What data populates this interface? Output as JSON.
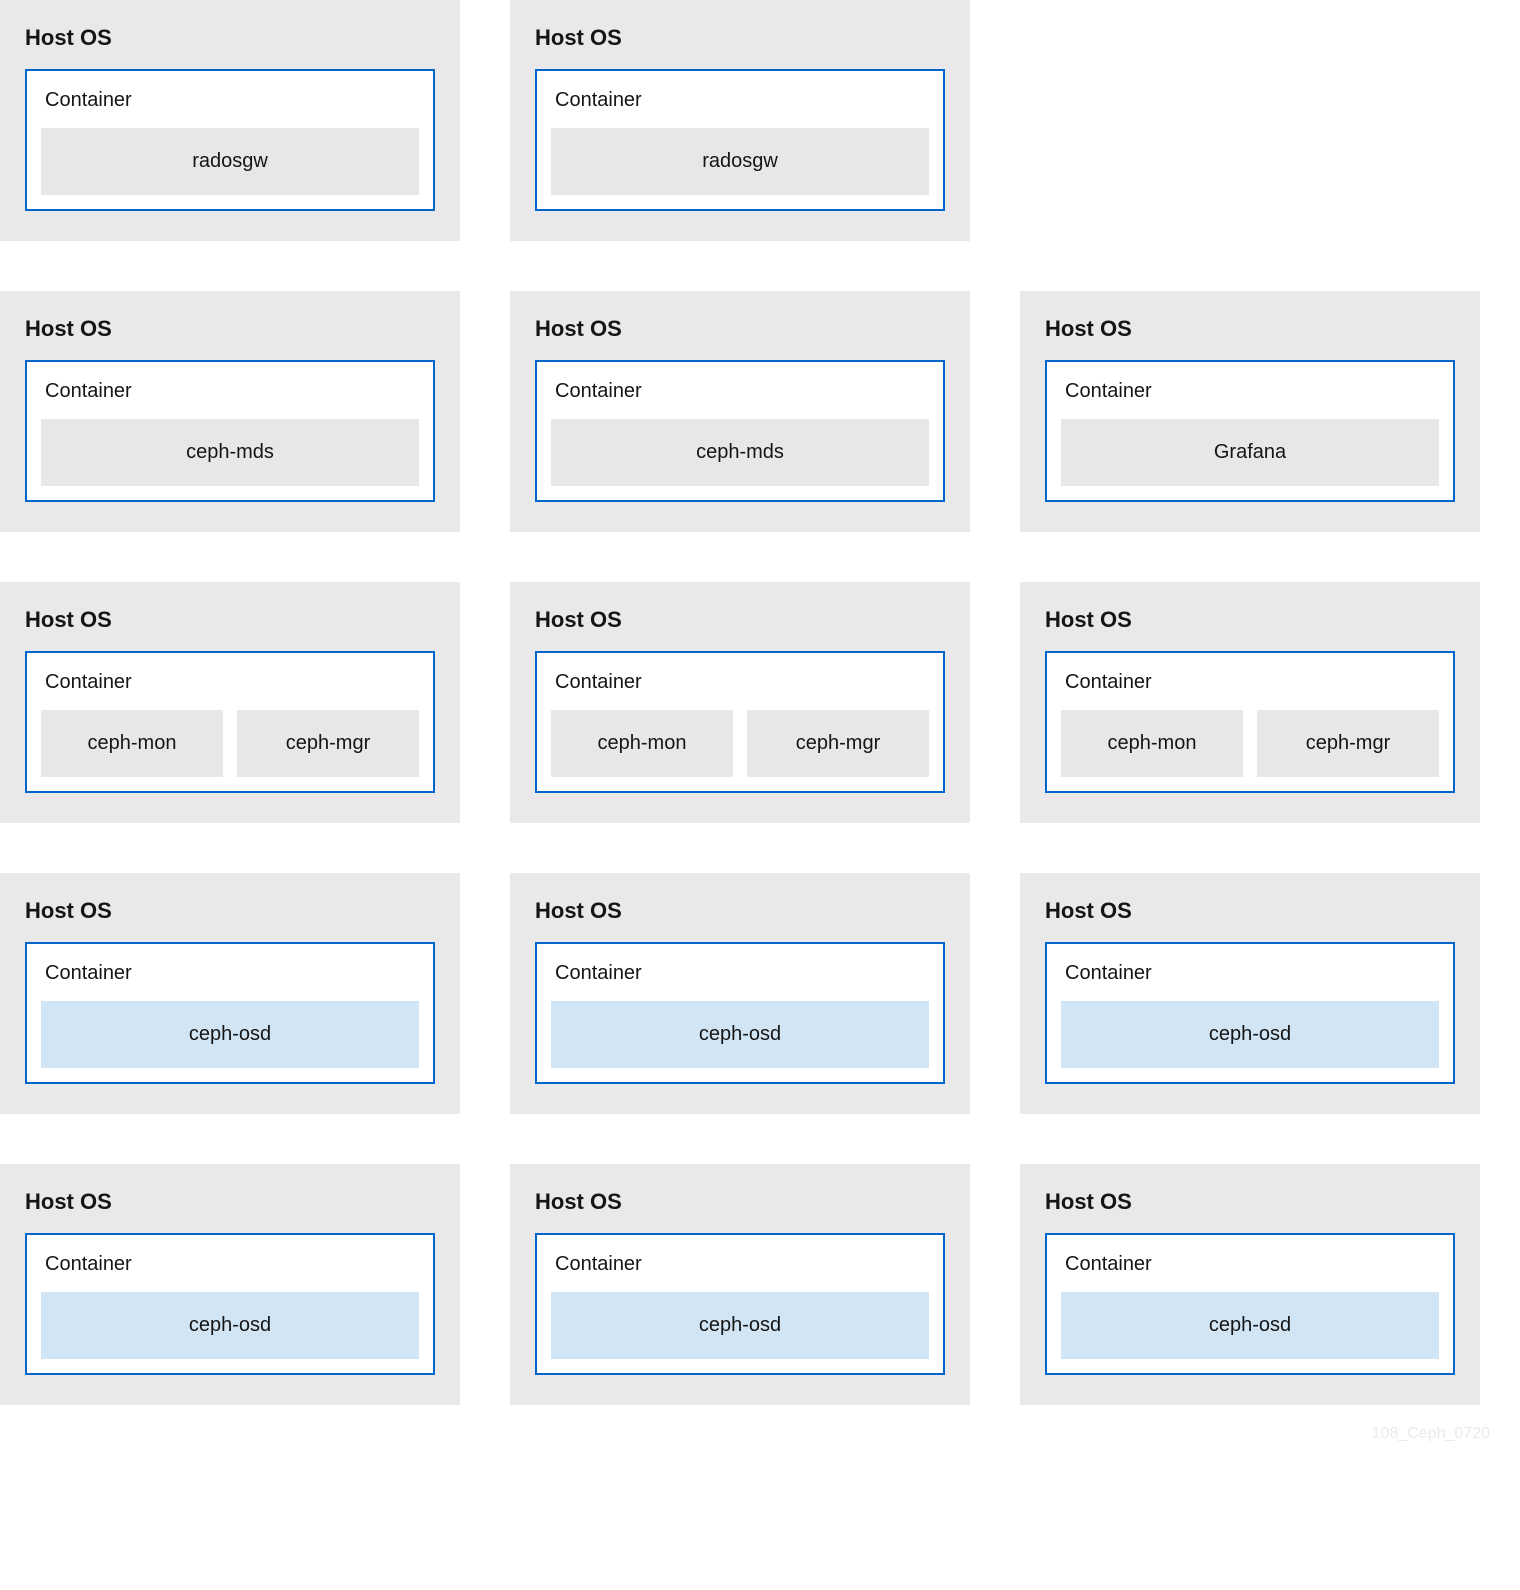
{
  "labels": {
    "host": "Host OS",
    "container": "Container"
  },
  "colors": {
    "host_bg": "#e9e9e9",
    "container_border": "#0066cc",
    "service_gray": "#e7e7e7",
    "service_blue": "#d1e5f5"
  },
  "rows": [
    {
      "hosts": [
        {
          "services": [
            {
              "name": "radosgw",
              "color": "gray"
            }
          ]
        },
        {
          "services": [
            {
              "name": "radosgw",
              "color": "gray"
            }
          ]
        },
        null
      ]
    },
    {
      "hosts": [
        {
          "services": [
            {
              "name": "ceph-mds",
              "color": "gray"
            }
          ]
        },
        {
          "services": [
            {
              "name": "ceph-mds",
              "color": "gray"
            }
          ]
        },
        {
          "services": [
            {
              "name": "Grafana",
              "color": "gray"
            }
          ]
        }
      ]
    },
    {
      "hosts": [
        {
          "services": [
            {
              "name": "ceph-mon",
              "color": "gray"
            },
            {
              "name": "ceph-mgr",
              "color": "gray"
            }
          ]
        },
        {
          "services": [
            {
              "name": "ceph-mon",
              "color": "gray"
            },
            {
              "name": "ceph-mgr",
              "color": "gray"
            }
          ]
        },
        {
          "services": [
            {
              "name": "ceph-mon",
              "color": "gray"
            },
            {
              "name": "ceph-mgr",
              "color": "gray"
            }
          ]
        }
      ]
    },
    {
      "hosts": [
        {
          "services": [
            {
              "name": "ceph-osd",
              "color": "blue"
            }
          ]
        },
        {
          "services": [
            {
              "name": "ceph-osd",
              "color": "blue"
            }
          ]
        },
        {
          "services": [
            {
              "name": "ceph-osd",
              "color": "blue"
            }
          ]
        }
      ]
    },
    {
      "hosts": [
        {
          "services": [
            {
              "name": "ceph-osd",
              "color": "blue"
            }
          ]
        },
        {
          "services": [
            {
              "name": "ceph-osd",
              "color": "blue"
            }
          ]
        },
        {
          "services": [
            {
              "name": "ceph-osd",
              "color": "blue"
            }
          ]
        }
      ]
    }
  ],
  "footer": "108_Ceph_0720"
}
